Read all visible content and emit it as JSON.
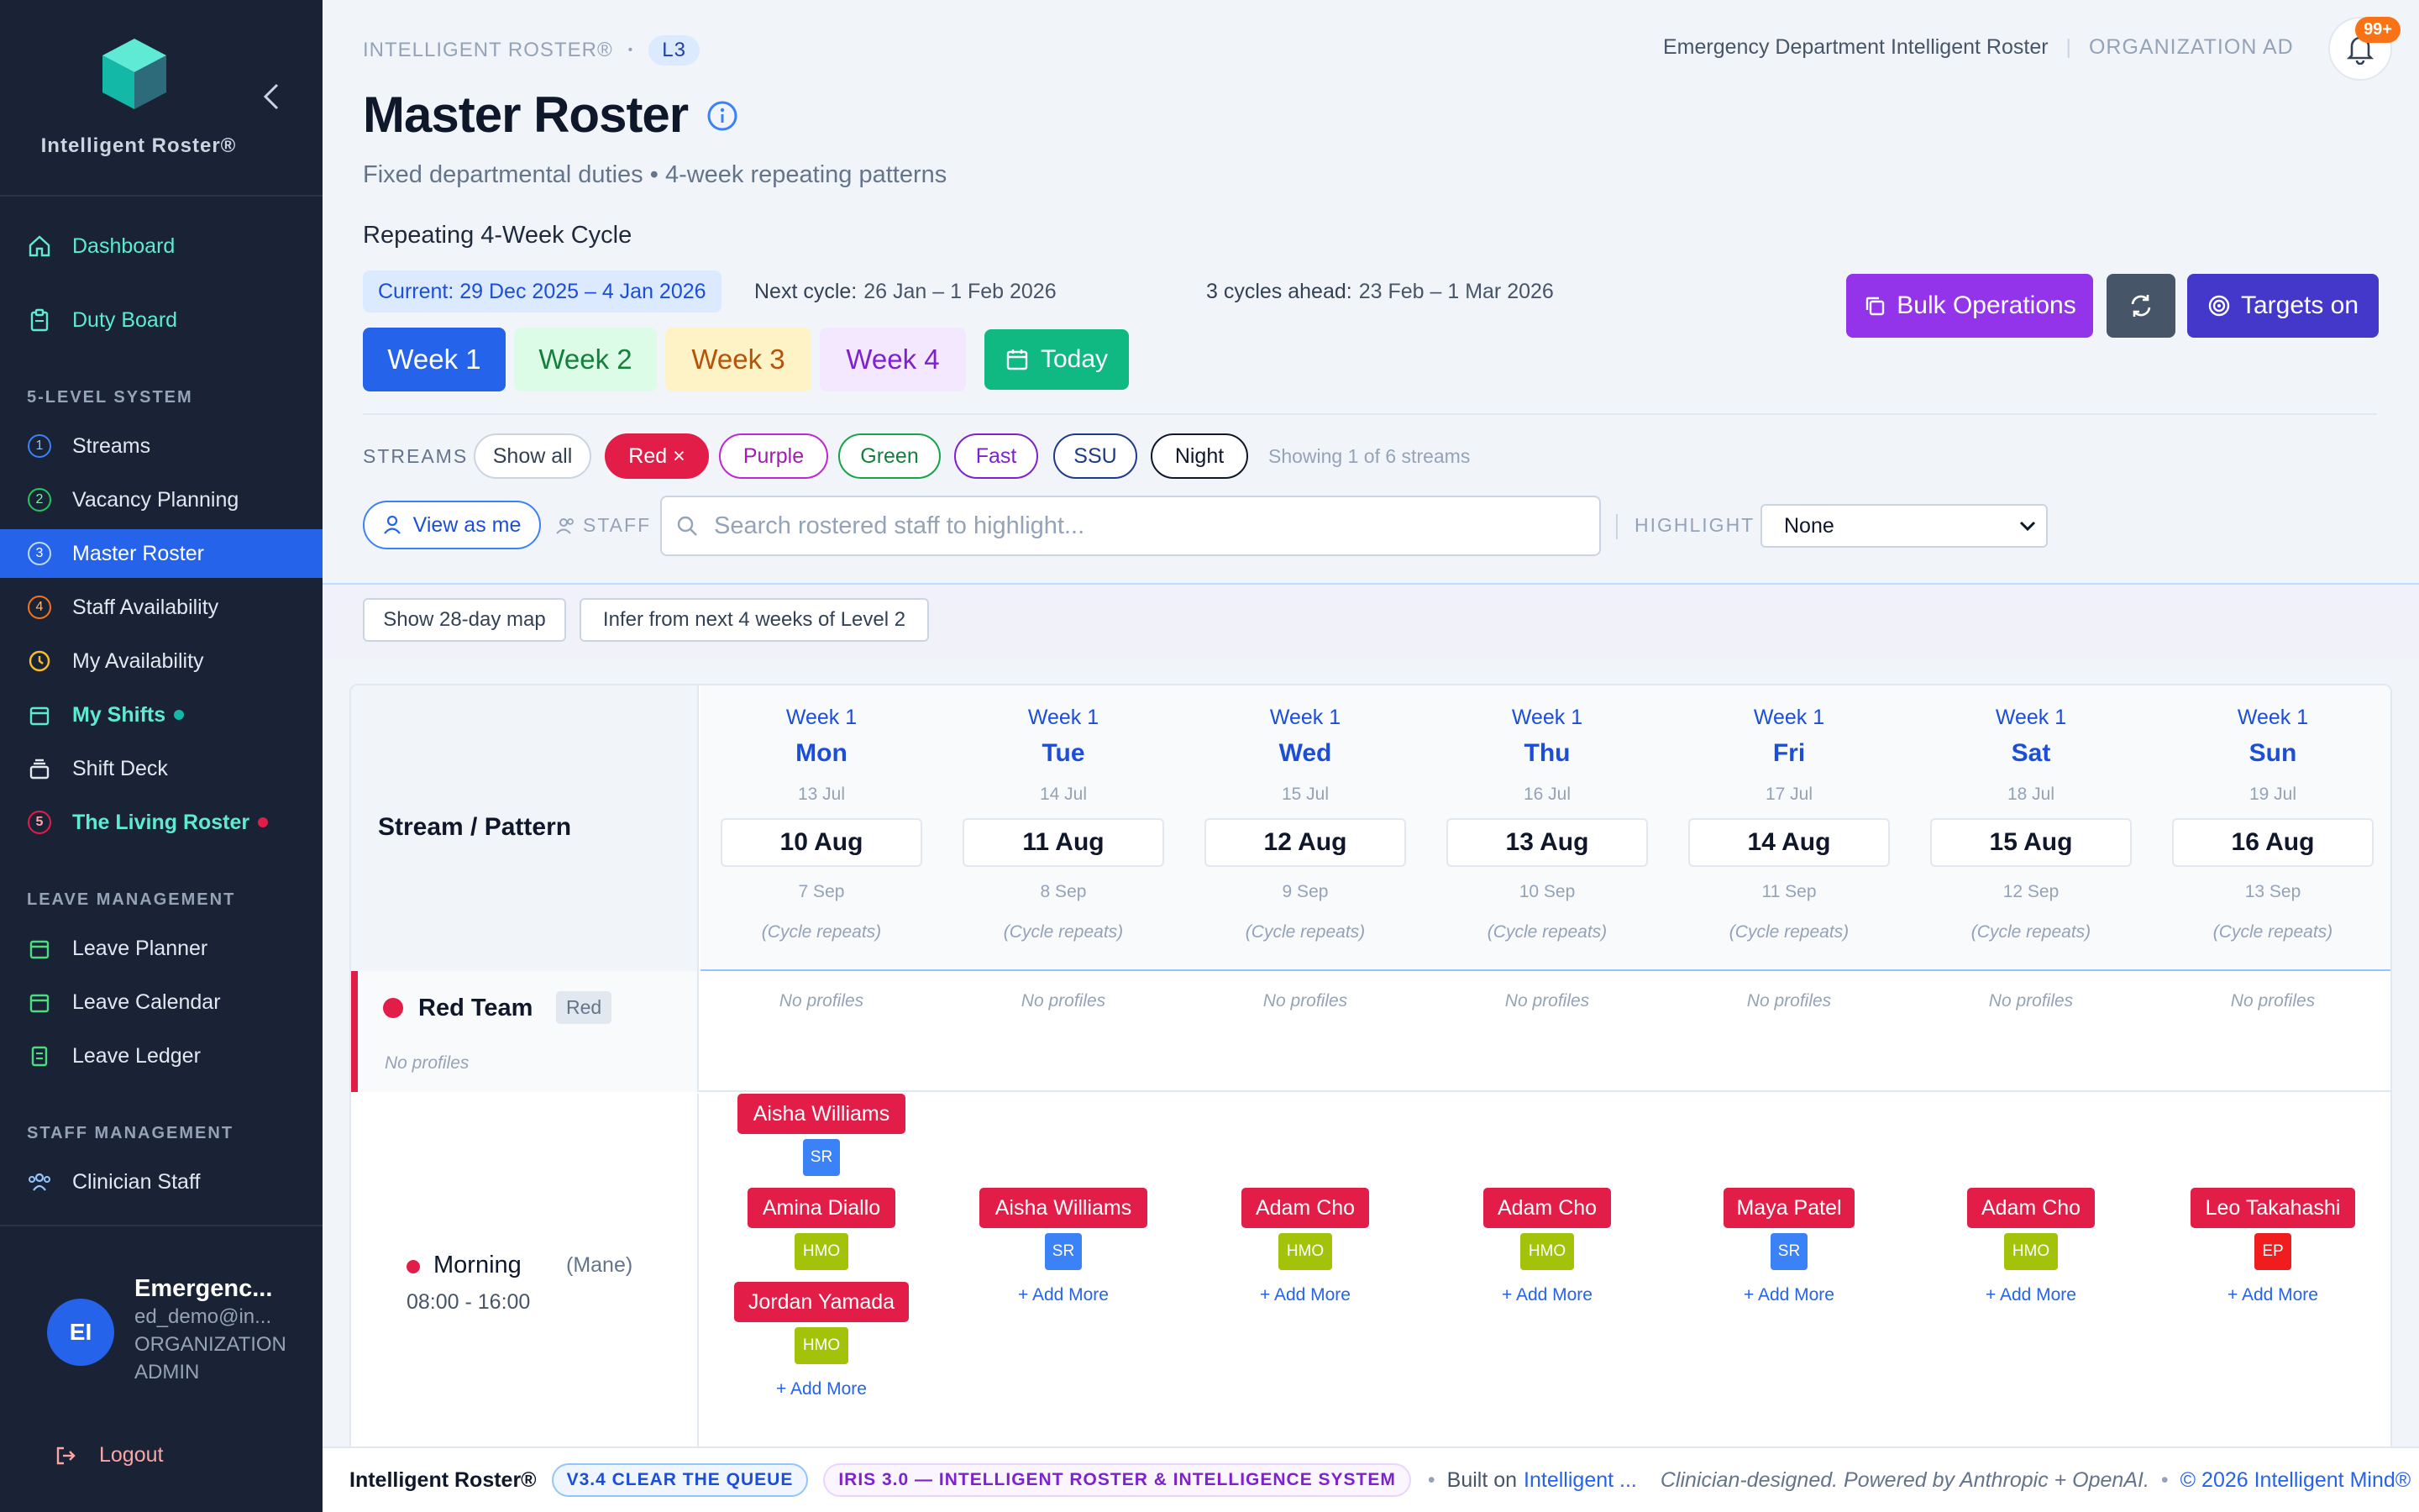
{
  "sidebar": {
    "brand": "Intelligent Roster®",
    "nav_top": [
      {
        "label": "Dashboard",
        "icon": "home-icon"
      },
      {
        "label": "Duty Board",
        "icon": "clipboard-icon"
      }
    ],
    "section_5level": "5-LEVEL SYSTEM",
    "levels": [
      {
        "num": "1",
        "label": "Streams"
      },
      {
        "num": "2",
        "label": "Vacancy Planning"
      },
      {
        "num": "3",
        "label": "Master Roster"
      },
      {
        "num": "4",
        "label": "Staff Availability"
      },
      {
        "label": "My Availability"
      },
      {
        "label": "My Shifts"
      },
      {
        "label": "Shift Deck"
      },
      {
        "num": "5",
        "label": "The Living Roster"
      }
    ],
    "section_leave": "LEAVE MANAGEMENT",
    "leave": [
      "Leave Planner",
      "Leave Calendar",
      "Leave Ledger"
    ],
    "section_staff": "STAFF MANAGEMENT",
    "staff": [
      "Clinician Staff"
    ],
    "user": {
      "initials": "EI",
      "name": "Emergenc...",
      "email": "ed_demo@in...",
      "role1": "ORGANIZATION",
      "role2": "ADMIN"
    },
    "logout": "Logout"
  },
  "header": {
    "crumb": "INTELLIGENT ROSTER®",
    "crumb_sep": "•",
    "level": "L3",
    "org_name": "Emergency Department Intelligent Roster",
    "org_sep": "|",
    "org_role": "ORGANIZATION AD",
    "notifications": "99+",
    "title": "Master Roster",
    "subtitle": "Fixed departmental duties • 4-week repeating patterns"
  },
  "cycle": {
    "title": "Repeating 4-Week Cycle",
    "current": "Current: 29 Dec 2025 – 4 Jan 2026",
    "next_label": "Next cycle:",
    "next": "26 Jan – 1 Feb 2026",
    "ahead_label": "3 cycles ahead:",
    "ahead": "23 Feb – 1 Mar 2026",
    "weeks": [
      "Week 1",
      "Week 2",
      "Week 3",
      "Week 4"
    ],
    "today": "Today"
  },
  "actions": {
    "bulk": "Bulk Operations",
    "targets": "Targets on"
  },
  "streams": {
    "label": "STREAMS",
    "chips": [
      "Show all",
      "Red ×",
      "Purple",
      "Green",
      "Fast",
      "SSU",
      "Night"
    ],
    "showing": "Showing 1 of 6 streams"
  },
  "filters": {
    "view_as_me": "View as me",
    "staff_label": "STAFF",
    "search_placeholder": "Search rostered staff to highlight...",
    "highlight_label": "HIGHLIGHT",
    "highlight_value": "None"
  },
  "tools": {
    "map": "Show 28-day map",
    "infer": "Infer from next 4 weeks of Level 2"
  },
  "grid": {
    "corner": "Stream / Pattern",
    "days": [
      {
        "week": "Week 1",
        "day": "Mon",
        "d1": "13 Jul",
        "d2": "10 Aug",
        "d3": "7 Sep"
      },
      {
        "week": "Week 1",
        "day": "Tue",
        "d1": "14 Jul",
        "d2": "11 Aug",
        "d3": "8 Sep"
      },
      {
        "week": "Week 1",
        "day": "Wed",
        "d1": "15 Jul",
        "d2": "12 Aug",
        "d3": "9 Sep"
      },
      {
        "week": "Week 1",
        "day": "Thu",
        "d1": "16 Jul",
        "d2": "13 Aug",
        "d3": "10 Sep"
      },
      {
        "week": "Week 1",
        "day": "Fri",
        "d1": "17 Jul",
        "d2": "14 Aug",
        "d3": "11 Sep"
      },
      {
        "week": "Week 1",
        "day": "Sat",
        "d1": "18 Jul",
        "d2": "15 Aug",
        "d3": "12 Sep"
      },
      {
        "week": "Week 1",
        "day": "Sun",
        "d1": "19 Jul",
        "d2": "16 Aug",
        "d3": "13 Sep"
      }
    ],
    "cycle_repeats": "(Cycle repeats)",
    "team": {
      "name": "Red Team",
      "tag": "Red",
      "note": "No profiles"
    },
    "no_profiles": "No profiles",
    "shift": {
      "name": "Morning",
      "alias": "(Mane)",
      "time": "08:00 - 16:00"
    },
    "add_more": "+ Add More",
    "assignments": [
      {
        "name": "Aisha Williams",
        "tag": "SR"
      },
      {
        "name": "Amina Diallo",
        "tag": "HMO"
      },
      {
        "name": "Jordan Yamada",
        "tag": "HMO"
      },
      {
        "name": "Aisha Williams",
        "tag": "SR"
      },
      {
        "name": "Adam Cho",
        "tag": "HMO"
      },
      {
        "name": "Adam Cho",
        "tag": "HMO"
      },
      {
        "name": "Maya Patel",
        "tag": "SR"
      },
      {
        "name": "Adam Cho",
        "tag": "HMO"
      },
      {
        "name": "Leo Takahashi",
        "tag": "EP"
      }
    ]
  },
  "footer": {
    "brand": "Intelligent Roster®",
    "version": "V3.4 CLEAR THE QUEUE",
    "iris": "IRIS 3.0 — INTELLIGENT ROSTER & INTELLIGENCE SYSTEM",
    "sep": "•",
    "built_on": "Built on",
    "built_link": "Intelligent ...",
    "powered": "Clinician-designed. Powered by Anthropic + OpenAI.",
    "copyright": "© 2026 Intelligent Mind®"
  },
  "colors": {
    "accent": "#2563eb",
    "red_stream": "#e11d48",
    "purple": "#9333ea",
    "green": "#16a34a",
    "sidebar_bg": "#1a2236"
  }
}
